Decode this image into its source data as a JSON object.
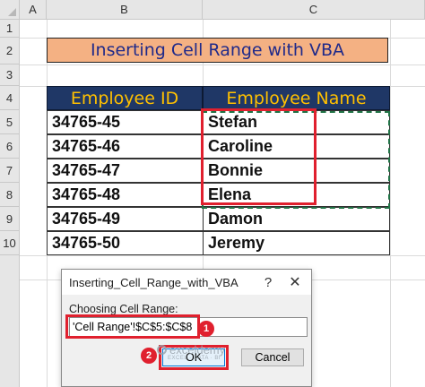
{
  "sheet": {
    "columns": [
      "A",
      "B",
      "C"
    ],
    "rows": [
      "1",
      "2",
      "3",
      "4",
      "5",
      "6",
      "7",
      "8",
      "9",
      "10"
    ]
  },
  "title": "Inserting Cell Range with VBA",
  "table": {
    "headers": [
      "Employee ID",
      "Employee Name"
    ],
    "rows": [
      [
        "34765-45",
        "Stefan"
      ],
      [
        "34765-46",
        "Caroline"
      ],
      [
        "34765-47",
        "Bonnie"
      ],
      [
        "34765-48",
        "Elena"
      ],
      [
        "34765-49",
        "Damon"
      ],
      [
        "34765-50",
        "Jeremy"
      ]
    ]
  },
  "dialog": {
    "title": "Inserting_Cell_Range_with_VBA",
    "help_glyph": "?",
    "close_glyph": "✕",
    "prompt": "Choosing Cell Range:",
    "input_value": "'Cell Range'!$C$5:$C$8",
    "ok_label": "OK",
    "cancel_label": "Cancel"
  },
  "callouts": {
    "one": "1",
    "two": "2"
  },
  "watermark": {
    "name": "exceldemy",
    "tagline": "EXCEL · DATA · BI"
  },
  "colors": {
    "title_fill": "#f4b183",
    "title_text": "#1f2a8a",
    "header_fill": "#1f3766",
    "header_text": "#ffc000",
    "highlight": "#e0202e",
    "copy_border": "#217346"
  }
}
